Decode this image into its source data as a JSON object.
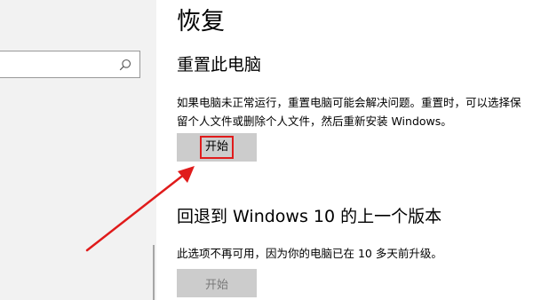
{
  "colors": {
    "sidebar_bg": "#f2f2f2",
    "button_bg": "#cccccc",
    "annotation_red": "#e01b1b",
    "disabled_text": "#7a7a7a"
  },
  "sidebar": {
    "search": {
      "value": "",
      "icon": "search-icon"
    }
  },
  "main": {
    "title": "恢复",
    "reset": {
      "title": "重置此电脑",
      "description": "如果电脑未正常运行，重置电脑可能会解决问题。重置时，可以选择保留个人文件或删除个人文件，然后重新安装 Windows。",
      "button_label": "开始"
    },
    "rollback": {
      "title": "回退到 Windows 10 的上一个版本",
      "description": "此选项不再可用，因为你的电脑已在 10 多天前升级。",
      "button_label": "开始",
      "button_enabled": false
    }
  }
}
